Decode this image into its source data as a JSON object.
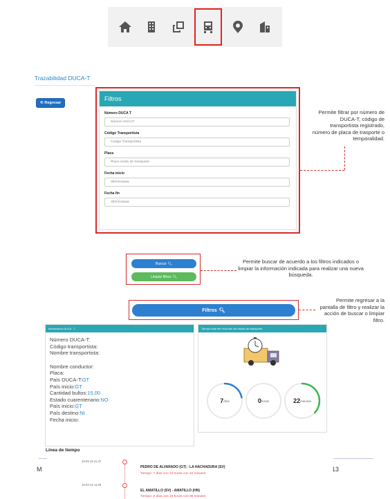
{
  "nav": {
    "items": [
      {
        "icon": "home-icon"
      },
      {
        "icon": "building-icon"
      },
      {
        "icon": "copy-icon"
      },
      {
        "icon": "truck-icon",
        "active": true
      },
      {
        "icon": "location-icon"
      },
      {
        "icon": "warehouse-icon"
      }
    ]
  },
  "breadcrumb": "Trazabilidad DUCA-T",
  "back_button": "Regresar",
  "filters": {
    "title": "Filtros",
    "fields": [
      {
        "label": "Número DUCA T",
        "placeholder": "Número DUCAT"
      },
      {
        "label": "Código Transportista",
        "placeholder": "Código Transportista"
      },
      {
        "label": "Placa",
        "placeholder": "Placa medio de transporte"
      },
      {
        "label": "Fecha inicio",
        "placeholder": "dd/mm/aaaa"
      },
      {
        "label": "Fecha fin",
        "placeholder": "dd/mm/aaaa"
      }
    ]
  },
  "notes": {
    "filter": "Permite filtrar por número de DUCA-T, código de transportista registrado, número de placa de trasporte o temporalidad.",
    "search": "Permite buscar de acuerdo a los filtros indicados o limpiar la información indicada para realizar una nueva búsqueda.",
    "back": "Permite regresar a la pantalla de filtro y realizar la acción de buscar o limpiar filtro."
  },
  "buttons": {
    "buscar": "Buscar",
    "limpiar": "Limpiar filtros",
    "filtros": "Filtros"
  },
  "info": {
    "title": "Información DUCA - T",
    "rows_a": [
      {
        "label": "Número DUCA-T:",
        "value": ""
      },
      {
        "label": "Código transportista:",
        "value": ""
      },
      {
        "label": "Nombre transportista:",
        "value": ""
      }
    ],
    "rows_b": [
      {
        "label": "Nombre conductor:",
        "value": ""
      },
      {
        "label": "Placa:",
        "value": ""
      },
      {
        "label": "País DUCA-T:",
        "value": "GT"
      },
      {
        "label": "País inicio:",
        "value": "GT"
      },
      {
        "label": "Cantidad bultos:",
        "value": "15.00"
      },
      {
        "label": "Estado cuarentenario:",
        "value": "NO"
      },
      {
        "label": "País inicio:",
        "value": "GT"
      },
      {
        "label": "País destino:",
        "value": "NI"
      },
      {
        "label": "Fecha inicio:",
        "value": ""
      }
    ]
  },
  "time": {
    "title": "Tiempo total del recorrido del medio de transporte",
    "gauges": [
      {
        "value": "7",
        "unit": "días",
        "fraction": 0.22,
        "color": "#2d7fcf"
      },
      {
        "value": "0",
        "unit": "horas",
        "fraction": 0.0,
        "color": "#2d7fcf"
      },
      {
        "value": "22",
        "unit": "minutos",
        "fraction": 0.37,
        "color": "#3cb44b"
      }
    ]
  },
  "timeline": {
    "title": "Linea de tiempo",
    "entries": [
      {
        "date": "10-03-15 21:47",
        "route": "PEDRO DE ALVARADO (GT) - LA HACHADURA (SV)",
        "duration": "Tiempo: 7 días con 10 horas con 42 minutos"
      },
      {
        "date": "10-03-14 11:36",
        "route": "EL AMATILLO (SV) - AMATILLO (HN)",
        "duration": "Tiempo: 5 días con 16 horas con 06 minutos"
      }
    ]
  },
  "footer": {
    "left": "M",
    "page": "13"
  }
}
